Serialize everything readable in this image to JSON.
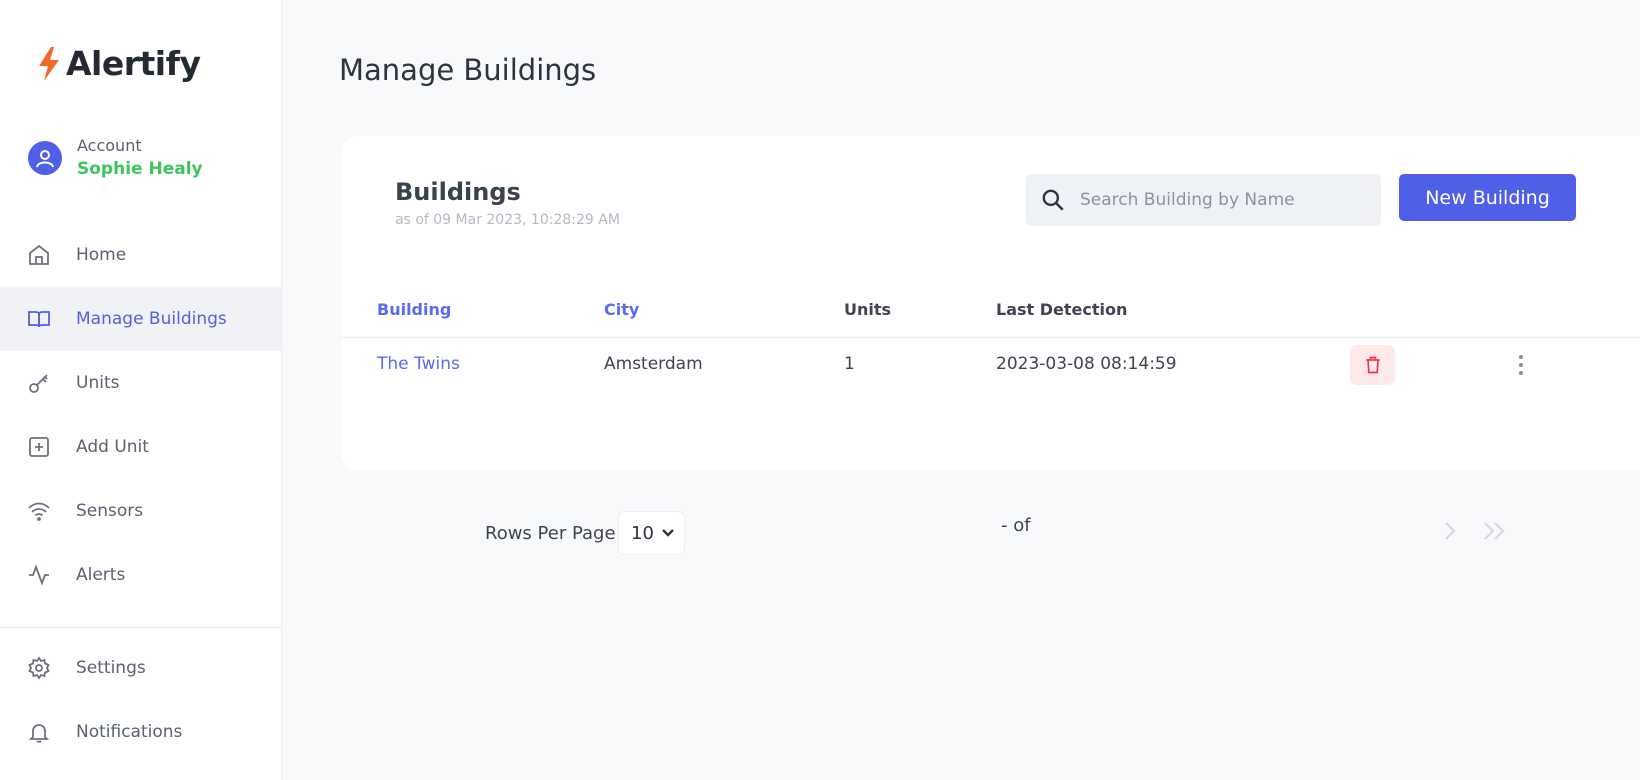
{
  "brand": {
    "name": "Alertify",
    "accent": "#4f5fe8",
    "logo_bolt_color": "#f26a2b"
  },
  "account": {
    "label": "Account",
    "name": "Sophie Healy"
  },
  "sidebar": {
    "items": [
      {
        "label": "Home",
        "icon": "home-icon",
        "active": false
      },
      {
        "label": "Manage Buildings",
        "icon": "book-icon",
        "active": true
      },
      {
        "label": "Units",
        "icon": "key-icon",
        "active": false
      },
      {
        "label": "Add Unit",
        "icon": "plus-square-icon",
        "active": false
      },
      {
        "label": "Sensors",
        "icon": "wifi-icon",
        "active": false
      },
      {
        "label": "Alerts",
        "icon": "activity-icon",
        "active": false
      }
    ],
    "bottom_items": [
      {
        "label": "Settings",
        "icon": "gear-icon"
      },
      {
        "label": "Notifications",
        "icon": "bell-icon"
      }
    ]
  },
  "page": {
    "title": "Manage Buildings"
  },
  "card": {
    "title": "Buildings",
    "subtitle": "as of 09 Mar 2023, 10:28:29 AM",
    "search_placeholder": "Search Building by Name",
    "new_button": "New Building"
  },
  "table": {
    "columns": [
      "Building",
      "City",
      "Units",
      "Last Detection"
    ],
    "rows": [
      {
        "building": "The Twins",
        "city": "Amsterdam",
        "units": "1",
        "last_detection": "2023-03-08 08:14:59"
      }
    ]
  },
  "pagination": {
    "rows_per_page_label": "Rows Per Page",
    "rows_per_page_value": "10",
    "range_text": "- of"
  }
}
